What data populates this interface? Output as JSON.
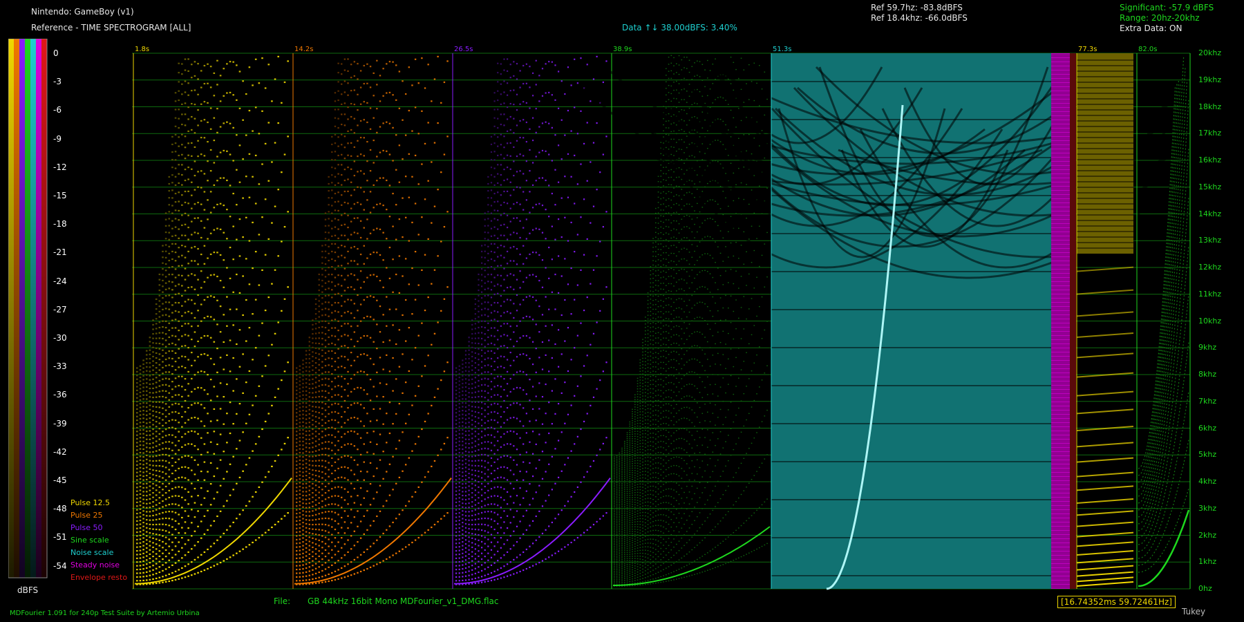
{
  "header": {
    "system": "Nintendo: GameBoy (v1)",
    "mode": "Reference - TIME SPECTROGRAM [ALL]",
    "data_note": "Data ↑↓ 38.00dBFS: 3.40%",
    "ref_line1": "Ref 59.7hz:  -83.8dBFS",
    "ref_line2": "Ref 18.4khz: -66.0dBFS",
    "significant": "Significant: -57.9 dBFS",
    "range": "Range: 20hz-20khz",
    "extra_data": "Extra Data: ON"
  },
  "footer": {
    "file_label": "File:",
    "file_info": "GB   44kHz 16bit Mono   MDFourier_v1_DMG.flac",
    "credit": "MDFourier 1.091 for 240p Test Suite by Artemio Urbina",
    "frame_info": "[16.74352ms 59.72461Hz]",
    "window": "Tukey"
  },
  "colorbar": {
    "unit_label": "dBFS",
    "ticks": [
      "0",
      "-3",
      "-6",
      "-9",
      "-12",
      "-15",
      "-18",
      "-21",
      "-24",
      "-27",
      "-30",
      "-33",
      "-36",
      "-39",
      "-42",
      "-45",
      "-48",
      "-51",
      "-54"
    ],
    "colors": [
      "#f0d800",
      "#f07800",
      "#8a1cff",
      "#1ed81e",
      "#1ecfcf",
      "#e000e0",
      "#e01818"
    ]
  },
  "chart_data": {
    "type": "heatmap",
    "title": "TIME SPECTROGRAM [ALL]",
    "y_axis": {
      "unit": "hz",
      "ticks": [
        "20khz",
        "19khz",
        "18khz",
        "17khz",
        "16khz",
        "15khz",
        "14khz",
        "13khz",
        "12khz",
        "11khz",
        "10khz",
        "9khz",
        "8khz",
        "7khz",
        "6khz",
        "5khz",
        "4khz",
        "3khz",
        "2khz",
        "1khz",
        "0hz"
      ],
      "range": [
        0,
        20000
      ]
    },
    "x_axis": {
      "unit": "s",
      "time_markers": [
        "1.8s",
        "14.2s",
        "26.5s",
        "38.9s",
        "51.3s",
        "77.3s",
        "82.0s"
      ]
    },
    "series": [
      {
        "name": "Pulse 12.5",
        "color": "#f0d800",
        "start": "1.8s",
        "end": "14.2s"
      },
      {
        "name": "Pulse 25",
        "color": "#f07800",
        "start": "14.2s",
        "end": "26.5s"
      },
      {
        "name": "Pulse 50",
        "color": "#8a1cff",
        "start": "26.5s",
        "end": "38.9s"
      },
      {
        "name": "Sine scale",
        "color": "#1ed81e",
        "start": "38.9s",
        "end": "51.3s"
      },
      {
        "name": "Noise scale",
        "color": "#1ecfcf",
        "start": "51.3s",
        "end": "77.3s"
      },
      {
        "name": "Steady noise",
        "color": "#e000e0"
      },
      {
        "name": "Envelope resto",
        "color": "#e01818"
      }
    ],
    "dbfs_range": [
      -57.9,
      0
    ]
  }
}
